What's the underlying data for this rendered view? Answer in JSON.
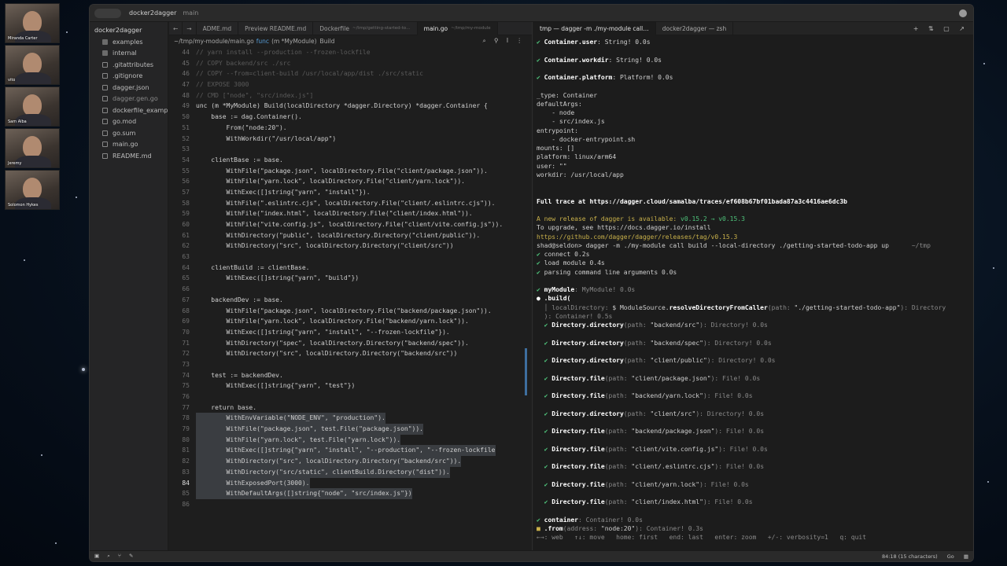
{
  "participants": [
    "Miranda Carter",
    "vito",
    "Sam Alba",
    "Jeremy",
    "Solomon Hykes"
  ],
  "window": {
    "title": "docker2dagger",
    "branch": "main"
  },
  "sidebar": {
    "root": "docker2dagger",
    "items": [
      {
        "label": "examples",
        "kind": "folder"
      },
      {
        "label": "internal",
        "kind": "folder"
      },
      {
        "label": ".gitattributes",
        "kind": "file"
      },
      {
        "label": ".gitignore",
        "kind": "file"
      },
      {
        "label": "dagger.json",
        "kind": "file"
      },
      {
        "label": "dagger.gen.go",
        "kind": "file"
      },
      {
        "label": "dockerfile_examp",
        "kind": "file"
      },
      {
        "label": "go.mod",
        "kind": "file"
      },
      {
        "label": "go.sum",
        "kind": "file"
      },
      {
        "label": "main.go",
        "kind": "file"
      },
      {
        "label": "README.md",
        "kind": "file"
      }
    ]
  },
  "editor_tabs": [
    {
      "label": "ADME.md",
      "sub": ""
    },
    {
      "label": "Preview README.md",
      "sub": ""
    },
    {
      "label": "Dockerfile",
      "sub": "~/tmp/getting-started-to…"
    },
    {
      "label": "main.go",
      "sub": "~/tmp/my-module",
      "active": true
    }
  ],
  "breadcrumb": {
    "path": "~/tmp/my-module/main.go",
    "kw": "func",
    "recv": "(m *MyModule)",
    "fn": "Build"
  },
  "code_lines": [
    {
      "n": "44",
      "t": "// yarn install --production --frozen-lockfile",
      "c": "cm"
    },
    {
      "n": "45",
      "t": "// COPY backend/src ./src",
      "c": "cm"
    },
    {
      "n": "46",
      "t": "// COPY --from=client-build /usr/local/app/dist ./src/static",
      "c": "cm"
    },
    {
      "n": "47",
      "t": "// EXPOSE 3000",
      "c": "cm"
    },
    {
      "n": "48",
      "t": "// CMD [\"node\", \"src/index.js\"]",
      "c": "cm"
    },
    {
      "n": "49",
      "t": "unc (m *MyModule) Build(localDirectory *dagger.Directory) *dagger.Container {"
    },
    {
      "n": "50",
      "t": "    base := dag.Container()."
    },
    {
      "n": "51",
      "t": "        From(\"node:20\")."
    },
    {
      "n": "52",
      "t": "        WithWorkdir(\"/usr/local/app\")"
    },
    {
      "n": "53",
      "t": ""
    },
    {
      "n": "54",
      "t": "    clientBase := base."
    },
    {
      "n": "55",
      "t": "        WithFile(\"package.json\", localDirectory.File(\"client/package.json\"))."
    },
    {
      "n": "56",
      "t": "        WithFile(\"yarn.lock\", localDirectory.File(\"client/yarn.lock\"))."
    },
    {
      "n": "57",
      "t": "        WithExec([]string{\"yarn\", \"install\"})."
    },
    {
      "n": "58",
      "t": "        WithFile(\".eslintrc.cjs\", localDirectory.File(\"client/.eslintrc.cjs\"))."
    },
    {
      "n": "59",
      "t": "        WithFile(\"index.html\", localDirectory.File(\"client/index.html\"))."
    },
    {
      "n": "60",
      "t": "        WithFile(\"vite.config.js\", localDirectory.File(\"client/vite.config.js\"))."
    },
    {
      "n": "61",
      "t": "        WithDirectory(\"public\", localDirectory.Directory(\"client/public\"))."
    },
    {
      "n": "62",
      "t": "        WithDirectory(\"src\", localDirectory.Directory(\"client/src\"))"
    },
    {
      "n": "63",
      "t": ""
    },
    {
      "n": "64",
      "t": "    clientBuild := clientBase."
    },
    {
      "n": "65",
      "t": "        WithExec([]string{\"yarn\", \"build\"})"
    },
    {
      "n": "66",
      "t": ""
    },
    {
      "n": "67",
      "t": "    backendDev := base."
    },
    {
      "n": "68",
      "t": "        WithFile(\"package.json\", localDirectory.File(\"backend/package.json\"))."
    },
    {
      "n": "69",
      "t": "        WithFile(\"yarn.lock\", localDirectory.File(\"backend/yarn.lock\"))."
    },
    {
      "n": "70",
      "t": "        WithExec([]string{\"yarn\", \"install\", \"--frozen-lockfile\"})."
    },
    {
      "n": "71",
      "t": "        WithDirectory(\"spec\", localDirectory.Directory(\"backend/spec\"))."
    },
    {
      "n": "72",
      "t": "        WithDirectory(\"src\", localDirectory.Directory(\"backend/src\"))"
    },
    {
      "n": "73",
      "t": ""
    },
    {
      "n": "74",
      "t": "    test := backendDev."
    },
    {
      "n": "75",
      "t": "        WithExec([]string{\"yarn\", \"test\"})"
    },
    {
      "n": "76",
      "t": ""
    },
    {
      "n": "77",
      "t": "    return base."
    },
    {
      "n": "78",
      "t": "        WithEnvVariable(\"NODE_ENV\", \"production\").",
      "sel": true
    },
    {
      "n": "79",
      "t": "        WithFile(\"package.json\", test.File(\"package.json\")).",
      "sel": true
    },
    {
      "n": "80",
      "t": "        WithFile(\"yarn.lock\", test.File(\"yarn.lock\")).",
      "sel": true
    },
    {
      "n": "81",
      "t": "        WithExec([]string{\"yarn\", \"install\", \"--production\", \"--frozen-lockfile",
      "sel": true
    },
    {
      "n": "82",
      "t": "        WithDirectory(\"src\", localDirectory.Directory(\"backend/src\")).",
      "sel": true
    },
    {
      "n": "83",
      "t": "        WithDirectory(\"src/static\", clientBuild.Directory(\"dist\")).",
      "sel": true
    },
    {
      "n": "84",
      "t": "        WithExposedPort(3000).",
      "sel": true,
      "cur": true
    },
    {
      "n": "85",
      "t": "        WithDefaultArgs([]string{\"node\", \"src/index.js\"})",
      "sel": true
    },
    {
      "n": "86",
      "t": ""
    }
  ],
  "term_tabs": [
    {
      "label": "tmp — dagger -m ./my-module call…",
      "active": true
    },
    {
      "label": "docker2dagger — zsh"
    }
  ],
  "term_lines": [
    {
      "p": [
        [
          "✔ ",
          "g"
        ],
        [
          "Container.",
          "b"
        ],
        [
          "user",
          "b"
        ],
        [
          ": String! 0.0s",
          ""
        ]
      ]
    },
    {
      "p": [
        [
          "",
          ""
        ]
      ]
    },
    {
      "p": [
        [
          "✔ ",
          "g"
        ],
        [
          "Container.",
          "b"
        ],
        [
          "workdir",
          "b"
        ],
        [
          ": String! 0.0s",
          ""
        ]
      ]
    },
    {
      "p": [
        [
          "",
          ""
        ]
      ]
    },
    {
      "p": [
        [
          "✔ ",
          "g"
        ],
        [
          "Container.",
          "b"
        ],
        [
          "platform",
          "b"
        ],
        [
          ": Platform! 0.0s",
          ""
        ]
      ]
    },
    {
      "p": [
        [
          "",
          ""
        ]
      ]
    },
    {
      "p": [
        [
          "_type: Container",
          ""
        ]
      ]
    },
    {
      "p": [
        [
          "defaultArgs:",
          ""
        ]
      ]
    },
    {
      "p": [
        [
          "    - node",
          ""
        ]
      ]
    },
    {
      "p": [
        [
          "    - src/index.js",
          ""
        ]
      ]
    },
    {
      "p": [
        [
          "entrypoint:",
          ""
        ]
      ]
    },
    {
      "p": [
        [
          "    - docker-entrypoint.sh",
          ""
        ]
      ]
    },
    {
      "p": [
        [
          "mounts: []",
          ""
        ]
      ]
    },
    {
      "p": [
        [
          "platform: linux/arm64",
          ""
        ]
      ]
    },
    {
      "p": [
        [
          "user: \"\"",
          ""
        ]
      ]
    },
    {
      "p": [
        [
          "workdir: /usr/local/app",
          ""
        ]
      ]
    },
    {
      "p": [
        [
          "",
          ""
        ]
      ]
    },
    {
      "p": [
        [
          "",
          ""
        ]
      ]
    },
    {
      "p": [
        [
          "Full trace at ",
          "b"
        ],
        [
          "https://dagger.cloud/samalba/traces/ef608b67bf01bada87a3c4416ae6dc3b",
          "b"
        ]
      ]
    },
    {
      "p": [
        [
          "",
          ""
        ]
      ]
    },
    {
      "p": [
        [
          "A new release of dagger is available: ",
          "y"
        ],
        [
          "v0.15.2 → v0.15.3",
          "g"
        ]
      ]
    },
    {
      "p": [
        [
          "To upgrade, see https://docs.dagger.io/install",
          ""
        ]
      ]
    },
    {
      "p": [
        [
          "https://github.com/dagger/dagger/releases/tag/v0.15.3",
          "y"
        ]
      ]
    },
    {
      "p": [
        [
          "shad@seldon> ",
          ""
        ],
        [
          "dagger -m ./my-module call build --local-directory ./getting-started-todo-app up",
          ""
        ],
        [
          "      ~/tmp",
          "dim"
        ]
      ]
    },
    {
      "p": [
        [
          "✔ ",
          "g"
        ],
        [
          "connect 0.2s",
          ""
        ]
      ]
    },
    {
      "p": [
        [
          "✔ ",
          "g"
        ],
        [
          "load module 0.4s",
          ""
        ]
      ]
    },
    {
      "p": [
        [
          "✔ ",
          "g"
        ],
        [
          "parsing command line arguments 0.0s",
          ""
        ]
      ]
    },
    {
      "p": [
        [
          "",
          ""
        ]
      ]
    },
    {
      "p": [
        [
          "✔ ",
          "g"
        ],
        [
          "myModule",
          "b"
        ],
        [
          ": MyModule! 0.0s",
          "dim"
        ]
      ]
    },
    {
      "p": [
        [
          "● ",
          "b"
        ],
        [
          ".build(",
          "b"
        ]
      ]
    },
    {
      "p": [
        [
          "  │ localDirectory: ",
          "dim"
        ],
        [
          "$ ModuleSource.",
          ""
        ],
        [
          "resolveDirectoryFromCaller",
          "b"
        ],
        [
          "(path: ",
          "dim"
        ],
        [
          "\"./getting-started-todo-app\"",
          ""
        ],
        [
          "): Directory",
          "dim"
        ]
      ]
    },
    {
      "p": [
        [
          "  ): Container! 0.5s",
          "dim"
        ]
      ]
    },
    {
      "p": [
        [
          "  ✔ ",
          "g"
        ],
        [
          "Directory.",
          "b"
        ],
        [
          "directory",
          "b"
        ],
        [
          "(path: ",
          "dim"
        ],
        [
          "\"backend/src\"",
          ""
        ],
        [
          "): Directory! 0.0s",
          "dim"
        ]
      ]
    },
    {
      "p": [
        [
          "",
          ""
        ]
      ]
    },
    {
      "p": [
        [
          "  ✔ ",
          "g"
        ],
        [
          "Directory.",
          "b"
        ],
        [
          "directory",
          "b"
        ],
        [
          "(path: ",
          "dim"
        ],
        [
          "\"backend/spec\"",
          ""
        ],
        [
          "): Directory! 0.0s",
          "dim"
        ]
      ]
    },
    {
      "p": [
        [
          "",
          ""
        ]
      ]
    },
    {
      "p": [
        [
          "  ✔ ",
          "g"
        ],
        [
          "Directory.",
          "b"
        ],
        [
          "directory",
          "b"
        ],
        [
          "(path: ",
          "dim"
        ],
        [
          "\"client/public\"",
          ""
        ],
        [
          "): Directory! 0.0s",
          "dim"
        ]
      ]
    },
    {
      "p": [
        [
          "",
          ""
        ]
      ]
    },
    {
      "p": [
        [
          "  ✔ ",
          "g"
        ],
        [
          "Directory.",
          "b"
        ],
        [
          "file",
          "b"
        ],
        [
          "(path: ",
          "dim"
        ],
        [
          "\"client/package.json\"",
          ""
        ],
        [
          "): File! 0.0s",
          "dim"
        ]
      ]
    },
    {
      "p": [
        [
          "",
          ""
        ]
      ]
    },
    {
      "p": [
        [
          "  ✔ ",
          "g"
        ],
        [
          "Directory.",
          "b"
        ],
        [
          "file",
          "b"
        ],
        [
          "(path: ",
          "dim"
        ],
        [
          "\"backend/yarn.lock\"",
          ""
        ],
        [
          "): File! 0.0s",
          "dim"
        ]
      ]
    },
    {
      "p": [
        [
          "",
          ""
        ]
      ]
    },
    {
      "p": [
        [
          "  ✔ ",
          "g"
        ],
        [
          "Directory.",
          "b"
        ],
        [
          "directory",
          "b"
        ],
        [
          "(path: ",
          "dim"
        ],
        [
          "\"client/src\"",
          ""
        ],
        [
          "): Directory! 0.0s",
          "dim"
        ]
      ]
    },
    {
      "p": [
        [
          "",
          ""
        ]
      ]
    },
    {
      "p": [
        [
          "  ✔ ",
          "g"
        ],
        [
          "Directory.",
          "b"
        ],
        [
          "file",
          "b"
        ],
        [
          "(path: ",
          "dim"
        ],
        [
          "\"backend/package.json\"",
          ""
        ],
        [
          "): File! 0.0s",
          "dim"
        ]
      ]
    },
    {
      "p": [
        [
          "",
          ""
        ]
      ]
    },
    {
      "p": [
        [
          "  ✔ ",
          "g"
        ],
        [
          "Directory.",
          "b"
        ],
        [
          "file",
          "b"
        ],
        [
          "(path: ",
          "dim"
        ],
        [
          "\"client/vite.config.js\"",
          ""
        ],
        [
          "): File! 0.0s",
          "dim"
        ]
      ]
    },
    {
      "p": [
        [
          "",
          ""
        ]
      ]
    },
    {
      "p": [
        [
          "  ✔ ",
          "g"
        ],
        [
          "Directory.",
          "b"
        ],
        [
          "file",
          "b"
        ],
        [
          "(path: ",
          "dim"
        ],
        [
          "\"client/.eslintrc.cjs\"",
          ""
        ],
        [
          "): File! 0.0s",
          "dim"
        ]
      ]
    },
    {
      "p": [
        [
          "",
          ""
        ]
      ]
    },
    {
      "p": [
        [
          "  ✔ ",
          "g"
        ],
        [
          "Directory.",
          "b"
        ],
        [
          "file",
          "b"
        ],
        [
          "(path: ",
          "dim"
        ],
        [
          "\"client/yarn.lock\"",
          ""
        ],
        [
          "): File! 0.0s",
          "dim"
        ]
      ]
    },
    {
      "p": [
        [
          "",
          ""
        ]
      ]
    },
    {
      "p": [
        [
          "  ✔ ",
          "g"
        ],
        [
          "Directory.",
          "b"
        ],
        [
          "file",
          "b"
        ],
        [
          "(path: ",
          "dim"
        ],
        [
          "\"client/index.html\"",
          ""
        ],
        [
          "): File! 0.0s",
          "dim"
        ]
      ]
    },
    {
      "p": [
        [
          "",
          ""
        ]
      ]
    },
    {
      "p": [
        [
          "✔ ",
          "g"
        ],
        [
          "container",
          "b"
        ],
        [
          ": Container! 0.0s",
          "dim"
        ]
      ]
    },
    {
      "p": [
        [
          "■ ",
          "y"
        ],
        [
          ".from",
          "b"
        ],
        [
          "(address: ",
          "dim"
        ],
        [
          "\"node:20\"",
          ""
        ],
        [
          "): Container! 0.3s",
          "dim"
        ]
      ]
    },
    {
      "p": [
        [
          "←→: web   ↑↓: move   home: first   end: last   enter: zoom   +/-: verbosity=1   q: quit",
          "dim"
        ]
      ]
    }
  ],
  "status": {
    "position": "84:18 (15 characters)",
    "lang": "Go"
  }
}
